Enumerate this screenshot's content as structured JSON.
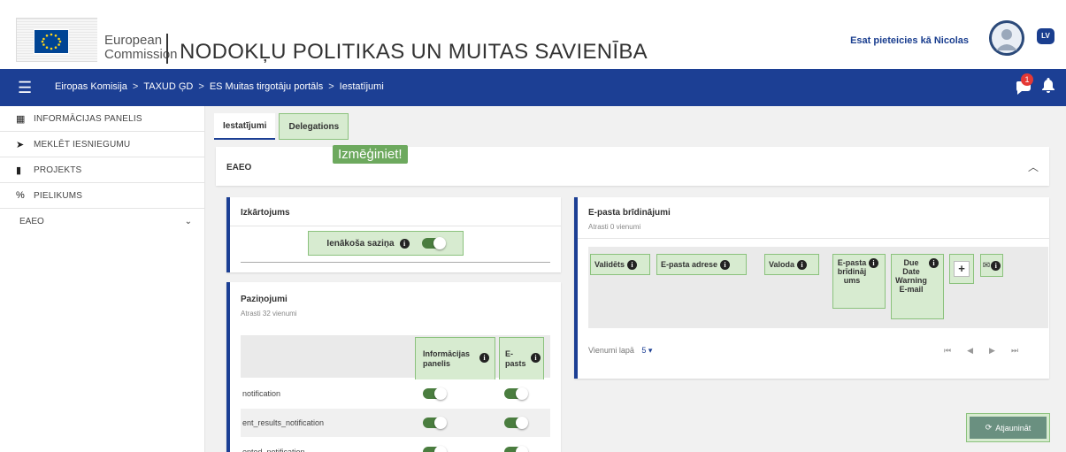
{
  "header": {
    "logo_line1": "European",
    "logo_line2": "Commission",
    "title": "NODOKĻU POLITIKAS UN MUITAS SAVIENĪBA",
    "user_text": "Esat pieteicies kā Nicolas",
    "language": "LV"
  },
  "nav": {
    "breadcrumbs": [
      "Eiropas Komisija",
      "TAXUD ĢD",
      "ES Muitas tirgotāju portāls",
      "Iestatījumi"
    ],
    "separator": ">",
    "notification_count": "1"
  },
  "sidebar": {
    "items": [
      {
        "label": "INFORMĀCIJAS PANELIS",
        "icon": "dashboard-icon"
      },
      {
        "label": "MEKLĒT IESNIEGUMU",
        "icon": "send-icon"
      },
      {
        "label": "PROJEKTS",
        "icon": "file-icon"
      },
      {
        "label": "PIELIKUMS",
        "icon": "attachment-icon"
      }
    ],
    "section": "EAEO"
  },
  "tabs": [
    "Iestatījumi",
    "Delegations"
  ],
  "try_label": "Izmēģiniet!",
  "eaeo_title": "EAEO",
  "layout_card": {
    "title": "Izkārtojums",
    "incoming_label": "Ienākoša saziņa"
  },
  "notifications_card": {
    "title": "Paziņojumi",
    "subtitle": "Atrasti 32 vienumi",
    "col1": "Informācijas panelis",
    "col2": "E-pasts",
    "rows": [
      "notification",
      "ent_results_notification",
      "epted_notification"
    ]
  },
  "email_card": {
    "title": "E-pasta brīdinājumi",
    "subtitle": "Atrasti 0 vienumi",
    "headers": [
      "Validēts",
      "E-pasta adrese",
      "Valoda",
      "E-pasta brīdinājums",
      "Due Date Warning E-mail"
    ],
    "per_page_label": "Vienumi lapā",
    "per_page_value": "5"
  },
  "refresh_label": "Atjaunināt"
}
